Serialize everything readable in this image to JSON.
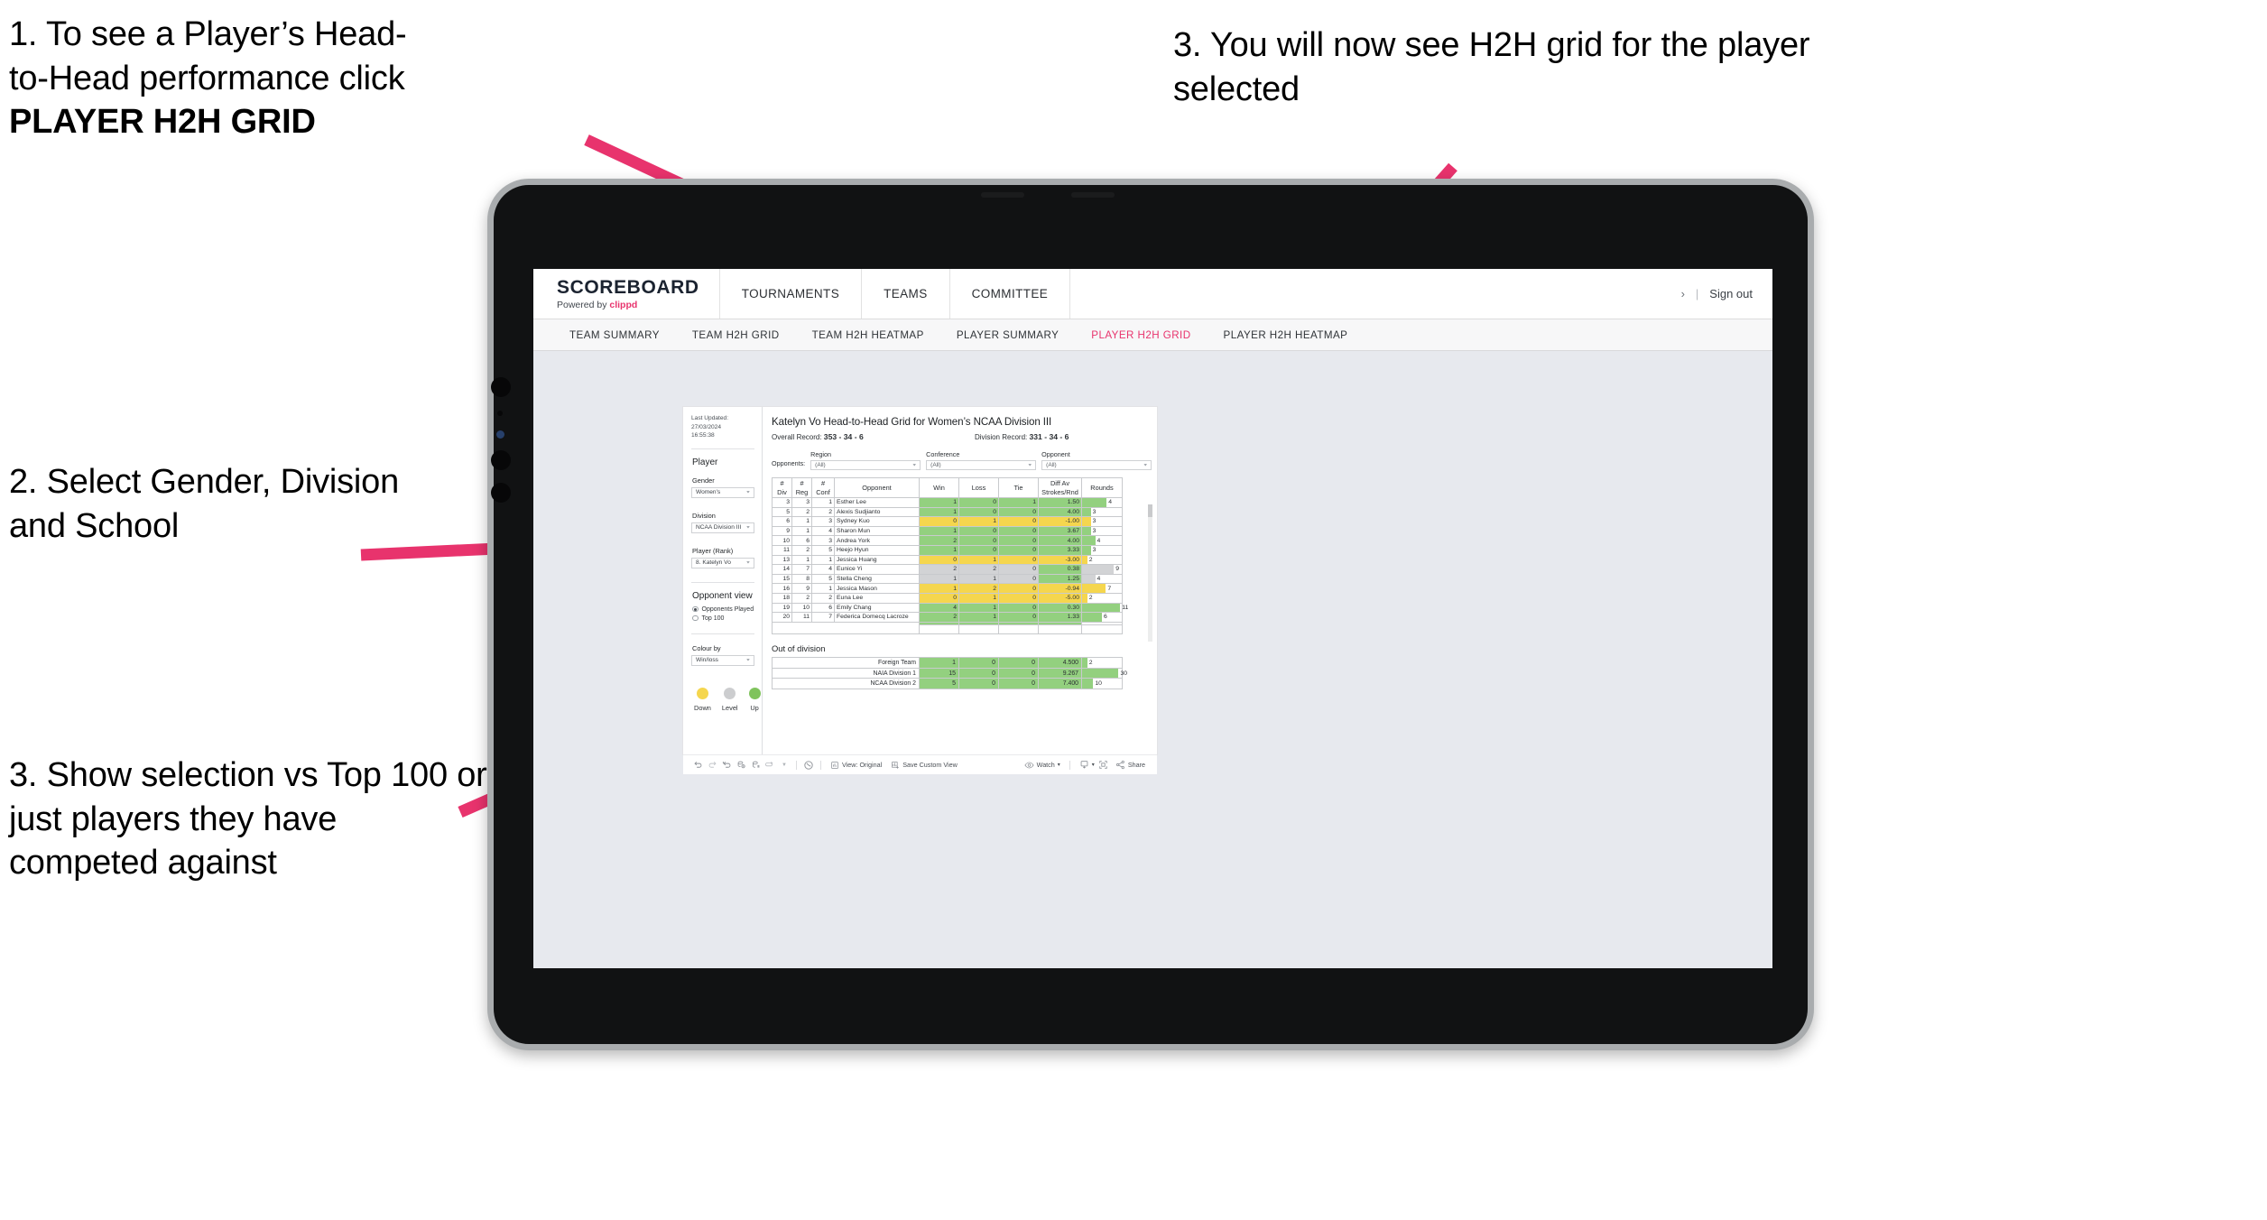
{
  "annotations": [
    {
      "id": "an1",
      "line1": "1. To see a Player’s Head-",
      "line2": "to-Head performance click",
      "line3": "PLAYER H2H GRID"
    },
    {
      "id": "an2",
      "text": "2. Select Gender, Division and School"
    },
    {
      "id": "an3",
      "text": "3. Show selection vs Top 100 or just players they have competed against"
    },
    {
      "id": "an4",
      "text": "3. You will now see H2H grid for the player selected"
    }
  ],
  "colors": {
    "accent_pink": "#e8336d",
    "arrow_pink": "#e8336d",
    "win_green": "#93d07f",
    "loss_yellow": "#f5d64e",
    "level_grey": "#d2d3d5"
  },
  "app": {
    "logo_main": "SCOREBOARD",
    "logo_sub_prefix": "Powered by ",
    "logo_sub_brand": "clippd",
    "nav": [
      "TOURNAMENTS",
      "TEAMS",
      "COMMITTEE"
    ],
    "account_chevron": "›",
    "separator": "|",
    "sign_out": "Sign out",
    "tabs": [
      {
        "label": "TEAM SUMMARY",
        "active": false
      },
      {
        "label": "TEAM H2H GRID",
        "active": false
      },
      {
        "label": "TEAM H2H HEATMAP",
        "active": false
      },
      {
        "label": "PLAYER SUMMARY",
        "active": false
      },
      {
        "label": "PLAYER H2H GRID",
        "active": true
      },
      {
        "label": "PLAYER H2H HEATMAP",
        "active": false
      }
    ]
  },
  "sidebar": {
    "last_updated_line1": "Last Updated: 27/03/2024",
    "last_updated_line2": "16:55:38",
    "player_heading": "Player",
    "gender_label": "Gender",
    "gender_value": "Women's",
    "division_label": "Division",
    "division_value": "NCAA Division III",
    "player_rank_label": "Player (Rank)",
    "player_rank_value": "8. Katelyn Vo",
    "opponent_view_heading": "Opponent view",
    "opponent_view_options": [
      {
        "label": "Opponents Played",
        "selected": true
      },
      {
        "label": "Top 100",
        "selected": false
      }
    ],
    "colour_by_label": "Colour by",
    "colour_by_value": "Win/loss",
    "legend": [
      {
        "label": "Down",
        "color": "#f5d64e"
      },
      {
        "label": "Level",
        "color": "#cccdcf"
      },
      {
        "label": "Up",
        "color": "#7fc35c"
      }
    ]
  },
  "sheet": {
    "title": "Katelyn Vo Head-to-Head Grid for Women’s NCAA Division III",
    "overall_record_label": "Overall Record: ",
    "overall_record_value": "353 - 34 - 6",
    "division_record_label": "Division Record: ",
    "division_record_value": "331 - 34 - 6",
    "opponents_label": "Opponents:",
    "filters": [
      {
        "caption": "Region",
        "value": "(All)"
      },
      {
        "caption": "Conference",
        "value": "(All)"
      },
      {
        "caption": "Opponent",
        "value": "(All)"
      }
    ],
    "columns": [
      "# Div",
      "# Reg",
      "# Conf",
      "Opponent",
      "Win",
      "Loss",
      "Tie",
      "Diff Av Strokes/Rnd",
      "Rounds"
    ],
    "column_lines": [
      [
        "#",
        "Div"
      ],
      [
        "#",
        "Reg"
      ],
      [
        "#",
        "Conf"
      ],
      [
        "Opponent",
        ""
      ],
      [
        "Win",
        ""
      ],
      [
        "Loss",
        ""
      ],
      [
        "Tie",
        ""
      ],
      [
        "Diff Av",
        "Strokes/Rnd"
      ],
      [
        "Rounds",
        ""
      ]
    ],
    "rows": [
      {
        "div": "3",
        "reg": "3",
        "conf": "1",
        "opponent": "Esther Lee",
        "win": "1",
        "loss": "0",
        "tie": "1",
        "diff": "1.50",
        "rounds": "4",
        "tone": "g",
        "bar": 62
      },
      {
        "div": "5",
        "reg": "2",
        "conf": "2",
        "opponent": "Alexis Sudjianto",
        "win": "1",
        "loss": "0",
        "tie": "0",
        "diff": "4.00",
        "rounds": "3",
        "tone": "g",
        "bar": 22
      },
      {
        "div": "6",
        "reg": "1",
        "conf": "3",
        "opponent": "Sydney Kuo",
        "win": "0",
        "loss": "1",
        "tie": "0",
        "diff": "-1.00",
        "rounds": "3",
        "tone": "y",
        "bar": 22
      },
      {
        "div": "9",
        "reg": "1",
        "conf": "4",
        "opponent": "Sharon Mun",
        "win": "1",
        "loss": "0",
        "tie": "0",
        "diff": "3.67",
        "rounds": "3",
        "tone": "g",
        "bar": 22
      },
      {
        "div": "10",
        "reg": "6",
        "conf": "3",
        "opponent": "Andrea York",
        "win": "2",
        "loss": "0",
        "tie": "0",
        "diff": "4.00",
        "rounds": "4",
        "tone": "g",
        "bar": 33
      },
      {
        "div": "11",
        "reg": "2",
        "conf": "5",
        "opponent": "Heejo Hyun",
        "win": "1",
        "loss": "0",
        "tie": "0",
        "diff": "3.33",
        "rounds": "3",
        "tone": "g",
        "bar": 22
      },
      {
        "div": "13",
        "reg": "1",
        "conf": "1",
        "opponent": "Jessica Huang",
        "win": "0",
        "loss": "1",
        "tie": "0",
        "diff": "-3.00",
        "rounds": "2",
        "tone": "y",
        "bar": 13
      },
      {
        "div": "14",
        "reg": "7",
        "conf": "4",
        "opponent": "Eunice Yi",
        "win": "2",
        "loss": "2",
        "tie": "0",
        "diff": "0.38",
        "rounds": "9",
        "tone": "gr",
        "bar": 80
      },
      {
        "div": "15",
        "reg": "8",
        "conf": "5",
        "opponent": "Stella Cheng",
        "win": "1",
        "loss": "1",
        "tie": "0",
        "diff": "1.25",
        "rounds": "4",
        "tone": "gr",
        "bar": 33
      },
      {
        "div": "16",
        "reg": "9",
        "conf": "1",
        "opponent": "Jessica Mason",
        "win": "1",
        "loss": "2",
        "tie": "0",
        "diff": "-0.94",
        "rounds": "7",
        "tone": "y",
        "bar": 60
      },
      {
        "div": "18",
        "reg": "2",
        "conf": "2",
        "opponent": "Euna Lee",
        "win": "0",
        "loss": "1",
        "tie": "0",
        "diff": "-5.00",
        "rounds": "2",
        "tone": "y",
        "bar": 13
      },
      {
        "div": "19",
        "reg": "10",
        "conf": "6",
        "opponent": "Emily Chang",
        "win": "4",
        "loss": "1",
        "tie": "0",
        "diff": "0.30",
        "rounds": "11",
        "tone": "g",
        "bar": 96
      },
      {
        "div": "20",
        "reg": "11",
        "conf": "7",
        "opponent": "Federica Domecq Lacroze",
        "win": "2",
        "loss": "1",
        "tie": "0",
        "diff": "1.33",
        "rounds": "6",
        "tone": "g",
        "bar": 50
      }
    ],
    "out_of_division_title": "Out of division",
    "out_of_division_rows": [
      {
        "name": "Foreign Team",
        "win": "1",
        "loss": "0",
        "tie": "0",
        "diff": "4.500",
        "rounds": "2",
        "bar": 13
      },
      {
        "name": "NAIA Division 1",
        "win": "15",
        "loss": "0",
        "tie": "0",
        "diff": "9.267",
        "rounds": "30",
        "bar": 92
      },
      {
        "name": "NCAA Division 2",
        "win": "5",
        "loss": "0",
        "tie": "0",
        "diff": "7.400",
        "rounds": "10",
        "bar": 28
      }
    ]
  },
  "toolbar": {
    "view_label": "View: Original",
    "save_label": "Save Custom View",
    "watch_label": "Watch",
    "share_label": "Share",
    "caret": "▾"
  }
}
